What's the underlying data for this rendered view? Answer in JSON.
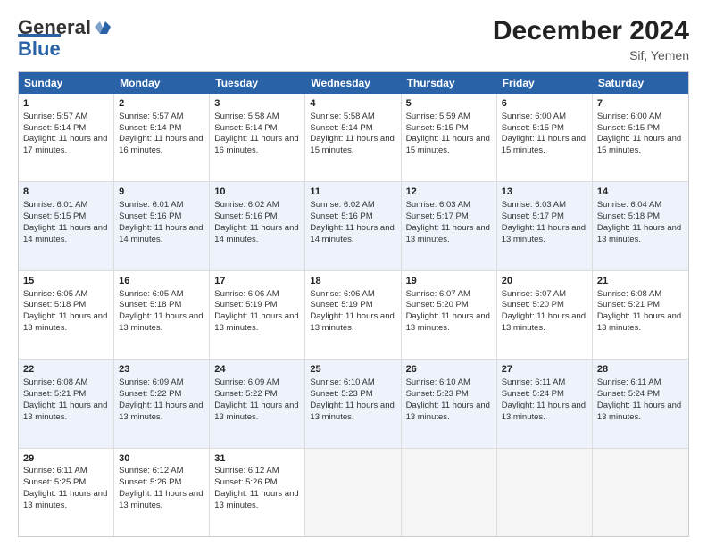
{
  "header": {
    "logo_general": "General",
    "logo_blue": "Blue",
    "month_year": "December 2024",
    "location": "Sif, Yemen"
  },
  "days_of_week": [
    "Sunday",
    "Monday",
    "Tuesday",
    "Wednesday",
    "Thursday",
    "Friday",
    "Saturday"
  ],
  "weeks": [
    [
      {
        "day": 1,
        "sunrise": "5:57 AM",
        "sunset": "5:14 PM",
        "daylight": "11 hours and 17 minutes."
      },
      {
        "day": 2,
        "sunrise": "5:57 AM",
        "sunset": "5:14 PM",
        "daylight": "11 hours and 16 minutes."
      },
      {
        "day": 3,
        "sunrise": "5:58 AM",
        "sunset": "5:14 PM",
        "daylight": "11 hours and 16 minutes."
      },
      {
        "day": 4,
        "sunrise": "5:58 AM",
        "sunset": "5:14 PM",
        "daylight": "11 hours and 15 minutes."
      },
      {
        "day": 5,
        "sunrise": "5:59 AM",
        "sunset": "5:15 PM",
        "daylight": "11 hours and 15 minutes."
      },
      {
        "day": 6,
        "sunrise": "6:00 AM",
        "sunset": "5:15 PM",
        "daylight": "11 hours and 15 minutes."
      },
      {
        "day": 7,
        "sunrise": "6:00 AM",
        "sunset": "5:15 PM",
        "daylight": "11 hours and 15 minutes."
      }
    ],
    [
      {
        "day": 8,
        "sunrise": "6:01 AM",
        "sunset": "5:15 PM",
        "daylight": "11 hours and 14 minutes."
      },
      {
        "day": 9,
        "sunrise": "6:01 AM",
        "sunset": "5:16 PM",
        "daylight": "11 hours and 14 minutes."
      },
      {
        "day": 10,
        "sunrise": "6:02 AM",
        "sunset": "5:16 PM",
        "daylight": "11 hours and 14 minutes."
      },
      {
        "day": 11,
        "sunrise": "6:02 AM",
        "sunset": "5:16 PM",
        "daylight": "11 hours and 14 minutes."
      },
      {
        "day": 12,
        "sunrise": "6:03 AM",
        "sunset": "5:17 PM",
        "daylight": "11 hours and 13 minutes."
      },
      {
        "day": 13,
        "sunrise": "6:03 AM",
        "sunset": "5:17 PM",
        "daylight": "11 hours and 13 minutes."
      },
      {
        "day": 14,
        "sunrise": "6:04 AM",
        "sunset": "5:18 PM",
        "daylight": "11 hours and 13 minutes."
      }
    ],
    [
      {
        "day": 15,
        "sunrise": "6:05 AM",
        "sunset": "5:18 PM",
        "daylight": "11 hours and 13 minutes."
      },
      {
        "day": 16,
        "sunrise": "6:05 AM",
        "sunset": "5:18 PM",
        "daylight": "11 hours and 13 minutes."
      },
      {
        "day": 17,
        "sunrise": "6:06 AM",
        "sunset": "5:19 PM",
        "daylight": "11 hours and 13 minutes."
      },
      {
        "day": 18,
        "sunrise": "6:06 AM",
        "sunset": "5:19 PM",
        "daylight": "11 hours and 13 minutes."
      },
      {
        "day": 19,
        "sunrise": "6:07 AM",
        "sunset": "5:20 PM",
        "daylight": "11 hours and 13 minutes."
      },
      {
        "day": 20,
        "sunrise": "6:07 AM",
        "sunset": "5:20 PM",
        "daylight": "11 hours and 13 minutes."
      },
      {
        "day": 21,
        "sunrise": "6:08 AM",
        "sunset": "5:21 PM",
        "daylight": "11 hours and 13 minutes."
      }
    ],
    [
      {
        "day": 22,
        "sunrise": "6:08 AM",
        "sunset": "5:21 PM",
        "daylight": "11 hours and 13 minutes."
      },
      {
        "day": 23,
        "sunrise": "6:09 AM",
        "sunset": "5:22 PM",
        "daylight": "11 hours and 13 minutes."
      },
      {
        "day": 24,
        "sunrise": "6:09 AM",
        "sunset": "5:22 PM",
        "daylight": "11 hours and 13 minutes."
      },
      {
        "day": 25,
        "sunrise": "6:10 AM",
        "sunset": "5:23 PM",
        "daylight": "11 hours and 13 minutes."
      },
      {
        "day": 26,
        "sunrise": "6:10 AM",
        "sunset": "5:23 PM",
        "daylight": "11 hours and 13 minutes."
      },
      {
        "day": 27,
        "sunrise": "6:11 AM",
        "sunset": "5:24 PM",
        "daylight": "11 hours and 13 minutes."
      },
      {
        "day": 28,
        "sunrise": "6:11 AM",
        "sunset": "5:24 PM",
        "daylight": "11 hours and 13 minutes."
      }
    ],
    [
      {
        "day": 29,
        "sunrise": "6:11 AM",
        "sunset": "5:25 PM",
        "daylight": "11 hours and 13 minutes."
      },
      {
        "day": 30,
        "sunrise": "6:12 AM",
        "sunset": "5:26 PM",
        "daylight": "11 hours and 13 minutes."
      },
      {
        "day": 31,
        "sunrise": "6:12 AM",
        "sunset": "5:26 PM",
        "daylight": "11 hours and 13 minutes."
      },
      null,
      null,
      null,
      null
    ]
  ]
}
